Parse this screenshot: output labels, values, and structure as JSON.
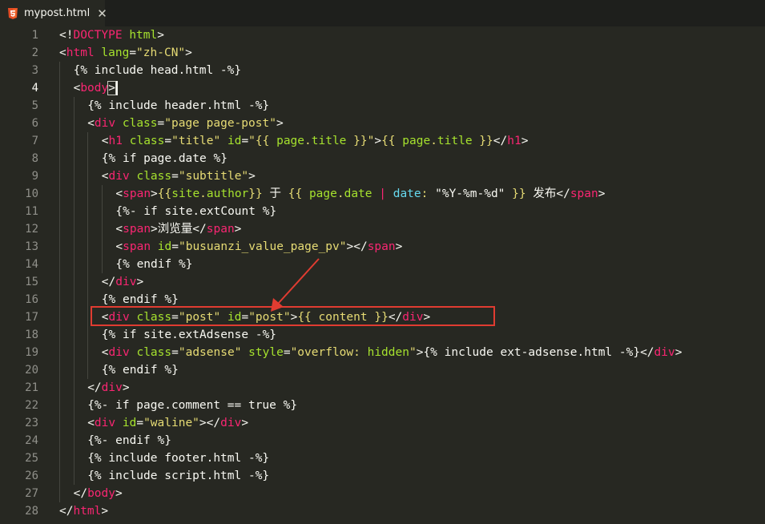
{
  "tab": {
    "title": "mypost.html",
    "icon": "html5-icon",
    "close": "✕"
  },
  "active_line": 4,
  "colors": {
    "background": "#272822",
    "tag": "#f92672",
    "attr": "#a6e22e",
    "string": "#e6db74",
    "annotation": "#e03c31"
  },
  "lines": [
    {
      "n": "1",
      "indent": 0,
      "tokens": [
        [
          "p",
          "<!"
        ],
        [
          "t",
          "DOCTYPE"
        ],
        [
          "p",
          " "
        ],
        [
          "a",
          "html"
        ],
        [
          "p",
          ">"
        ]
      ]
    },
    {
      "n": "2",
      "indent": 0,
      "tokens": [
        [
          "p",
          "<"
        ],
        [
          "t",
          "html"
        ],
        [
          "p",
          " "
        ],
        [
          "a",
          "lang"
        ],
        [
          "p",
          "="
        ],
        [
          "s",
          "\"zh-CN\""
        ],
        [
          "p",
          ">"
        ]
      ]
    },
    {
      "n": "3",
      "indent": 1,
      "tokens": [
        [
          "p",
          "{% include head.html -%}"
        ]
      ]
    },
    {
      "n": "4",
      "indent": 1,
      "tokens": [
        [
          "p",
          "<"
        ],
        [
          "t",
          "body"
        ],
        [
          "pm",
          ">"
        ],
        [
          "caret",
          ""
        ]
      ]
    },
    {
      "n": "5",
      "indent": 2,
      "tokens": [
        [
          "p",
          "{% include header.html -%}"
        ]
      ]
    },
    {
      "n": "6",
      "indent": 2,
      "tokens": [
        [
          "p",
          "<"
        ],
        [
          "t",
          "div"
        ],
        [
          "p",
          " "
        ],
        [
          "a",
          "class"
        ],
        [
          "p",
          "="
        ],
        [
          "s",
          "\"page page-post\""
        ],
        [
          "p",
          ">"
        ]
      ]
    },
    {
      "n": "7",
      "indent": 3,
      "tokens": [
        [
          "p",
          "<"
        ],
        [
          "t",
          "h1"
        ],
        [
          "p",
          " "
        ],
        [
          "a",
          "class"
        ],
        [
          "p",
          "="
        ],
        [
          "s",
          "\"title\""
        ],
        [
          "p",
          " "
        ],
        [
          "a",
          "id"
        ],
        [
          "p",
          "="
        ],
        [
          "s",
          "\"{{ "
        ],
        [
          "a",
          "page"
        ],
        [
          "s",
          "."
        ],
        [
          "a",
          "title"
        ],
        [
          "s",
          " }}\""
        ],
        [
          "p",
          ">"
        ],
        [
          "s",
          "{{ "
        ],
        [
          "a",
          "page"
        ],
        [
          "s",
          "."
        ],
        [
          "a",
          "title"
        ],
        [
          "s",
          " }}"
        ],
        [
          "p",
          "</"
        ],
        [
          "t",
          "h1"
        ],
        [
          "p",
          ">"
        ]
      ]
    },
    {
      "n": "8",
      "indent": 3,
      "tokens": [
        [
          "p",
          "{% if page.date %}"
        ]
      ]
    },
    {
      "n": "9",
      "indent": 3,
      "tokens": [
        [
          "p",
          "<"
        ],
        [
          "t",
          "div"
        ],
        [
          "p",
          " "
        ],
        [
          "a",
          "class"
        ],
        [
          "p",
          "="
        ],
        [
          "s",
          "\"subtitle\""
        ],
        [
          "p",
          ">"
        ]
      ]
    },
    {
      "n": "10",
      "indent": 4,
      "tokens": [
        [
          "p",
          "<"
        ],
        [
          "t",
          "span"
        ],
        [
          "p",
          ">"
        ],
        [
          "s",
          "{{"
        ],
        [
          "a",
          "site"
        ],
        [
          "s",
          "."
        ],
        [
          "a",
          "author"
        ],
        [
          "s",
          "}}"
        ],
        [
          "p",
          " 于 "
        ],
        [
          "s",
          "{{ "
        ],
        [
          "a",
          "page"
        ],
        [
          "s",
          "."
        ],
        [
          "a",
          "date"
        ],
        [
          "s",
          " "
        ],
        [
          "kw",
          "|"
        ],
        [
          "s",
          " "
        ],
        [
          "v",
          "date"
        ],
        [
          "s",
          ": "
        ],
        [
          "p",
          "\"%Y-%m-%d\""
        ],
        [
          "s",
          " }}"
        ],
        [
          "p",
          " 发布</"
        ],
        [
          "t",
          "span"
        ],
        [
          "p",
          ">"
        ]
      ]
    },
    {
      "n": "11",
      "indent": 4,
      "tokens": [
        [
          "p",
          "{%- if site.extCount %}"
        ]
      ]
    },
    {
      "n": "12",
      "indent": 4,
      "tokens": [
        [
          "p",
          "<"
        ],
        [
          "t",
          "span"
        ],
        [
          "p",
          ">浏览量</"
        ],
        [
          "t",
          "span"
        ],
        [
          "p",
          ">"
        ]
      ]
    },
    {
      "n": "13",
      "indent": 4,
      "tokens": [
        [
          "p",
          "<"
        ],
        [
          "t",
          "span"
        ],
        [
          "p",
          " "
        ],
        [
          "a",
          "id"
        ],
        [
          "p",
          "="
        ],
        [
          "s",
          "\"busuanzi_value_page_pv\""
        ],
        [
          "p",
          "></"
        ],
        [
          "t",
          "span"
        ],
        [
          "p",
          ">"
        ]
      ]
    },
    {
      "n": "14",
      "indent": 4,
      "tokens": [
        [
          "p",
          "{% endif %}"
        ]
      ]
    },
    {
      "n": "15",
      "indent": 3,
      "tokens": [
        [
          "p",
          "</"
        ],
        [
          "t",
          "div"
        ],
        [
          "p",
          ">"
        ]
      ]
    },
    {
      "n": "16",
      "indent": 3,
      "tokens": [
        [
          "p",
          "{% endif %}"
        ]
      ]
    },
    {
      "n": "17",
      "indent": 3,
      "tokens": [
        [
          "p",
          "<"
        ],
        [
          "t",
          "div"
        ],
        [
          "p",
          " "
        ],
        [
          "a",
          "class"
        ],
        [
          "p",
          "="
        ],
        [
          "s",
          "\"post\""
        ],
        [
          "p",
          " "
        ],
        [
          "a",
          "id"
        ],
        [
          "p",
          "="
        ],
        [
          "s",
          "\"post\""
        ],
        [
          "p",
          ">"
        ],
        [
          "s",
          "{{ content }}"
        ],
        [
          "p",
          "</"
        ],
        [
          "t",
          "div"
        ],
        [
          "p",
          ">"
        ]
      ]
    },
    {
      "n": "18",
      "indent": 3,
      "tokens": [
        [
          "p",
          "{% if site.extAdsense -%}"
        ]
      ]
    },
    {
      "n": "19",
      "indent": 3,
      "tokens": [
        [
          "p",
          "<"
        ],
        [
          "t",
          "div"
        ],
        [
          "p",
          " "
        ],
        [
          "a",
          "class"
        ],
        [
          "p",
          "="
        ],
        [
          "s",
          "\"adsense\""
        ],
        [
          "p",
          " "
        ],
        [
          "a",
          "style"
        ],
        [
          "p",
          "="
        ],
        [
          "s",
          "\"overflow: "
        ],
        [
          "a",
          "hidden"
        ],
        [
          "s",
          "\""
        ],
        [
          "p",
          ">{% include ext-adsense.html -%}</"
        ],
        [
          "t",
          "div"
        ],
        [
          "p",
          ">"
        ]
      ]
    },
    {
      "n": "20",
      "indent": 3,
      "tokens": [
        [
          "p",
          "{% endif %}"
        ]
      ]
    },
    {
      "n": "21",
      "indent": 2,
      "tokens": [
        [
          "p",
          "</"
        ],
        [
          "t",
          "div"
        ],
        [
          "p",
          ">"
        ]
      ]
    },
    {
      "n": "22",
      "indent": 2,
      "tokens": [
        [
          "p",
          "{%- if page.comment == true %}"
        ]
      ]
    },
    {
      "n": "23",
      "indent": 2,
      "tokens": [
        [
          "p",
          "<"
        ],
        [
          "t",
          "div"
        ],
        [
          "p",
          " "
        ],
        [
          "a",
          "id"
        ],
        [
          "p",
          "="
        ],
        [
          "s",
          "\"waline\""
        ],
        [
          "p",
          "></"
        ],
        [
          "t",
          "div"
        ],
        [
          "p",
          ">"
        ]
      ]
    },
    {
      "n": "24",
      "indent": 2,
      "tokens": [
        [
          "p",
          "{%- endif %}"
        ]
      ]
    },
    {
      "n": "25",
      "indent": 2,
      "tokens": [
        [
          "p",
          "{% include footer.html -%}"
        ]
      ]
    },
    {
      "n": "26",
      "indent": 2,
      "tokens": [
        [
          "p",
          "{% include script.html -%}"
        ]
      ]
    },
    {
      "n": "27",
      "indent": 1,
      "tokens": [
        [
          "p",
          "</"
        ],
        [
          "t",
          "body"
        ],
        [
          "p",
          ">"
        ]
      ]
    },
    {
      "n": "28",
      "indent": 0,
      "tokens": [
        [
          "p",
          "</"
        ],
        [
          "t",
          "html"
        ],
        [
          "p",
          ">"
        ]
      ]
    }
  ]
}
